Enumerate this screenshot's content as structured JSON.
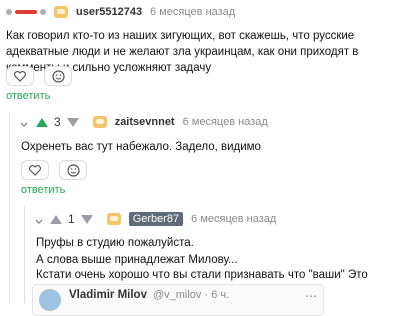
{
  "comment1": {
    "score": "",
    "username": "user5512743",
    "time": "6 месяцев назад",
    "text": "Как говорил кто-то из наших зигующих, вот скажешь, что русские адекватные люди и не желают зла украинцам, как они приходят в комменты и сильно усложняют задачу",
    "reply_label": "ответить"
  },
  "comment2": {
    "score": "3",
    "username": "zaitsevnnet",
    "time": "6 месяцев назад",
    "text": "Охренеть вас тут набежало. Задело, видимо",
    "reply_label": "ответить"
  },
  "comment3": {
    "score": "1",
    "username": "Gerber87",
    "time": "6 месяцев назад",
    "lines": [
      "Пруфы в студию пожалуйста.",
      "А слова выше принадлежат Милову...",
      "Кстати очень хорошо что вы стали признавать что \"ваши\" Это Зигующие..."
    ]
  },
  "embed": {
    "author": "Vladimir Milov",
    "handle": "@v_milov · 6 ч."
  },
  "colors": {
    "accent_green": "#26a65b",
    "downvote_red": "#e53935",
    "badge_gray": "#5f6b77"
  },
  "icons": [
    "upvote-arrow-icon",
    "downvote-arrow-icon",
    "user-badge-icon",
    "smile-icon",
    "collapse-icon",
    "more-icon"
  ]
}
